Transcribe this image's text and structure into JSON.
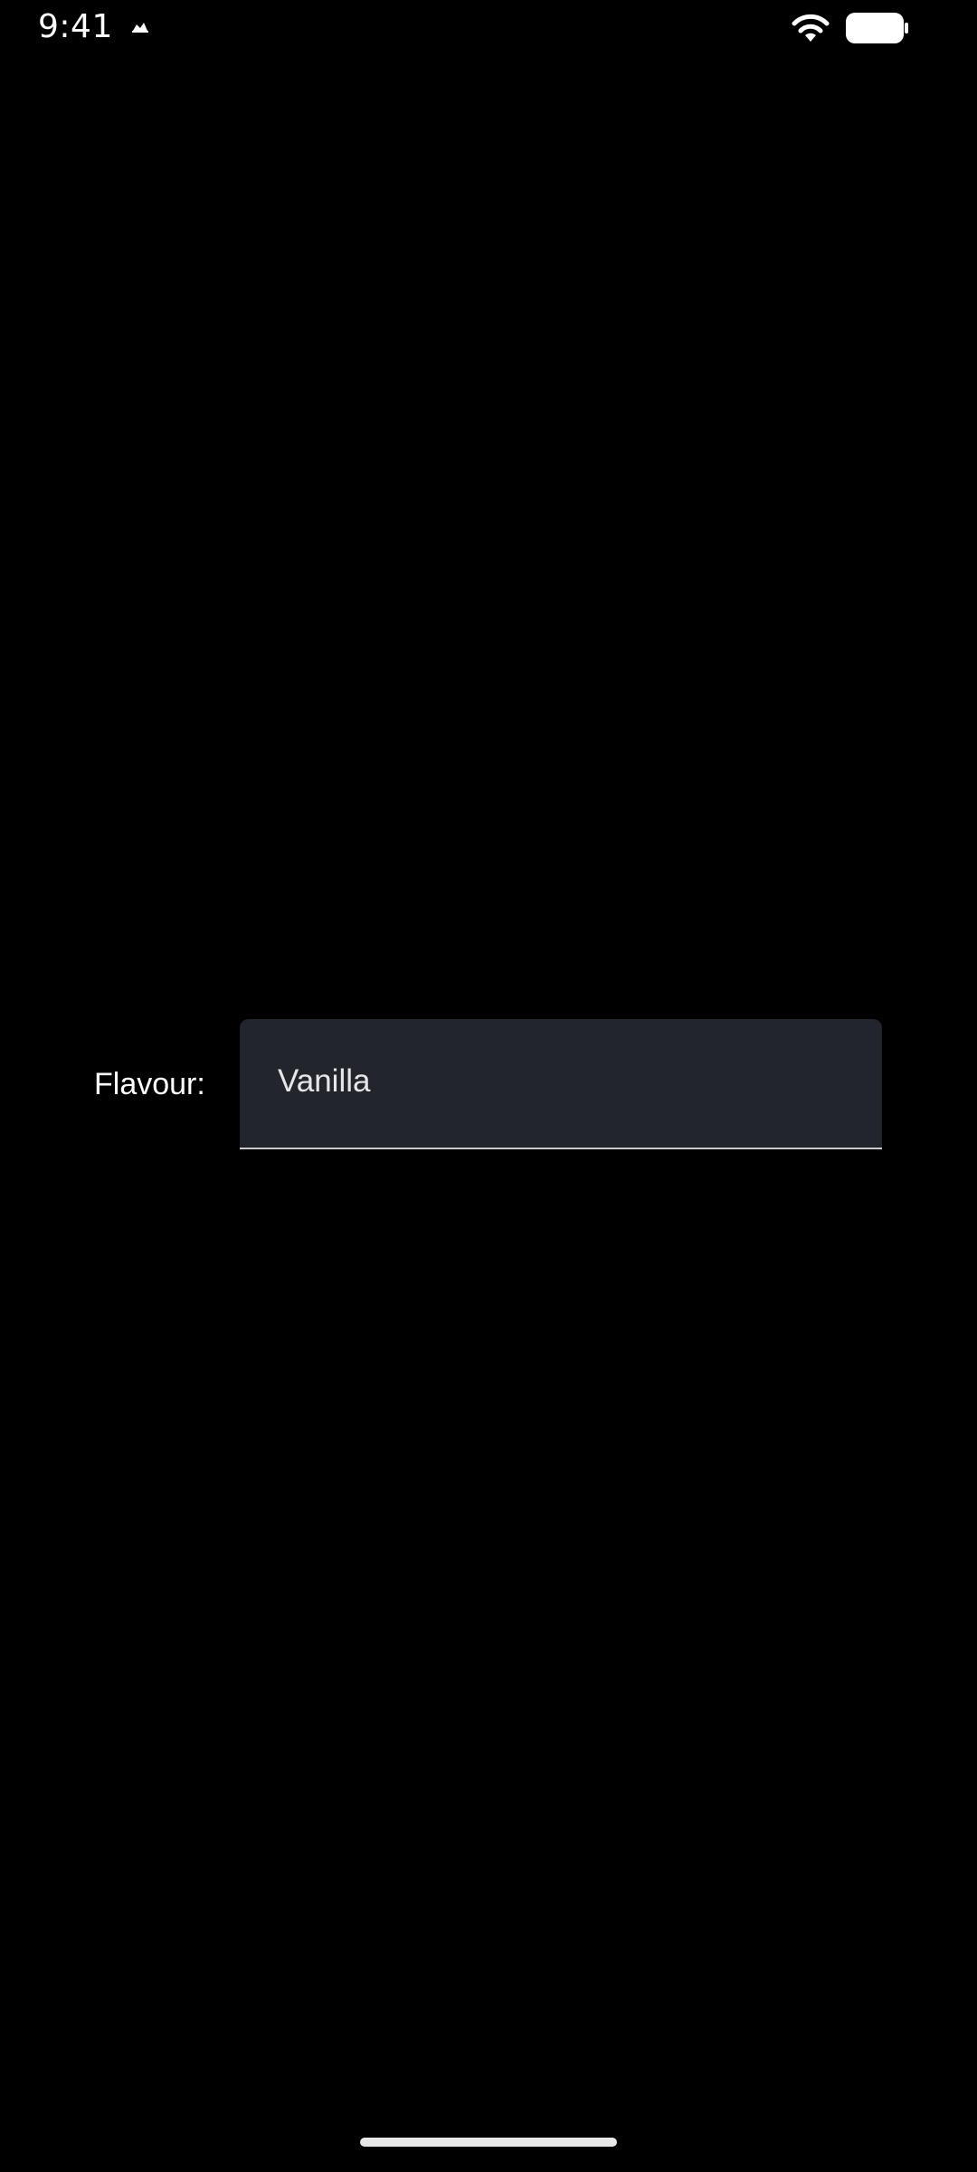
{
  "status_bar": {
    "time": "9:41",
    "icons": {
      "notification": "notification-icon",
      "wifi": "wifi-icon",
      "battery": "battery-icon"
    }
  },
  "form": {
    "flavour_label": "Flavour:",
    "flavour_value": "Vanilla"
  },
  "colors": {
    "background": "#000000",
    "field_fill": "#23252d",
    "field_underline": "#c9c9d0",
    "text": "#ffffff"
  }
}
